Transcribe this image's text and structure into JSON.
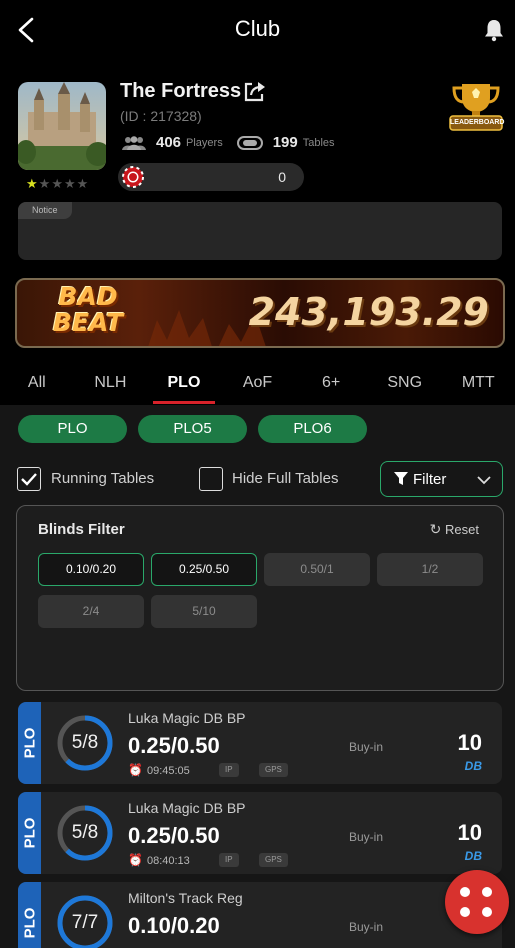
{
  "header": {
    "title": "Club"
  },
  "club": {
    "name": "The Fortress",
    "id_text": "(ID : 217328)",
    "players_count": "406",
    "players_label": "Players",
    "tables_count": "199",
    "tables_label": "Tables",
    "chips_value": "0",
    "rating": 1,
    "leaderboard_label": "LEADERBOARD",
    "notice_label": "Notice",
    "notice_text": ""
  },
  "jackpot": {
    "title_line1": "BAD",
    "title_line2": "BEAT",
    "amount": "243,193.29"
  },
  "tabs": [
    {
      "label": "All"
    },
    {
      "label": "NLH"
    },
    {
      "label": "PLO"
    },
    {
      "label": "AoF"
    },
    {
      "label": "6+"
    },
    {
      "label": "SNG"
    },
    {
      "label": "MTT"
    }
  ],
  "active_tab": "PLO",
  "subtabs": [
    {
      "label": "PLO"
    },
    {
      "label": "PLO5"
    },
    {
      "label": "PLO6"
    }
  ],
  "filters": {
    "running_tables_label": "Running Tables",
    "running_tables_checked": true,
    "hide_full_label": "Hide Full Tables",
    "hide_full_checked": false,
    "filter_label": "Filter"
  },
  "blinds_filter": {
    "title": "Blinds Filter",
    "reset_label": "Reset",
    "options": [
      {
        "label": "0.10/0.20",
        "selected": true
      },
      {
        "label": "0.25/0.50",
        "selected": true
      },
      {
        "label": "0.50/1",
        "selected": false
      },
      {
        "label": "1/2",
        "selected": false
      },
      {
        "label": "2/4",
        "selected": false
      },
      {
        "label": "5/10",
        "selected": false
      }
    ]
  },
  "tables": [
    {
      "game": "PLO",
      "seats": "5/8",
      "fill": 0.625,
      "name": "Luka Magic DB BP",
      "blinds": "0.25/0.50",
      "time": "09:45:05",
      "badges": [
        "IP",
        "GPS"
      ],
      "buyin_label": "Buy-in",
      "buyin": "10",
      "tag": "DB"
    },
    {
      "game": "PLO",
      "seats": "5/8",
      "fill": 0.625,
      "name": "Luka Magic DB BP",
      "blinds": "0.25/0.50",
      "time": "08:40:13",
      "badges": [
        "IP",
        "GPS"
      ],
      "buyin_label": "Buy-in",
      "buyin": "10",
      "tag": "DB"
    },
    {
      "game": "PLO",
      "seats": "7/7",
      "fill": 1.0,
      "name": "Milton's Track Reg",
      "blinds": "0.10/0.20",
      "time": "",
      "badges": [],
      "buyin_label": "Buy-in",
      "buyin": "",
      "tag": ""
    }
  ],
  "colors": {
    "accent_green": "#1d7a45",
    "tab_indicator": "#d8222a",
    "game_tag": "#1e63b8",
    "fab": "#d8322e"
  }
}
